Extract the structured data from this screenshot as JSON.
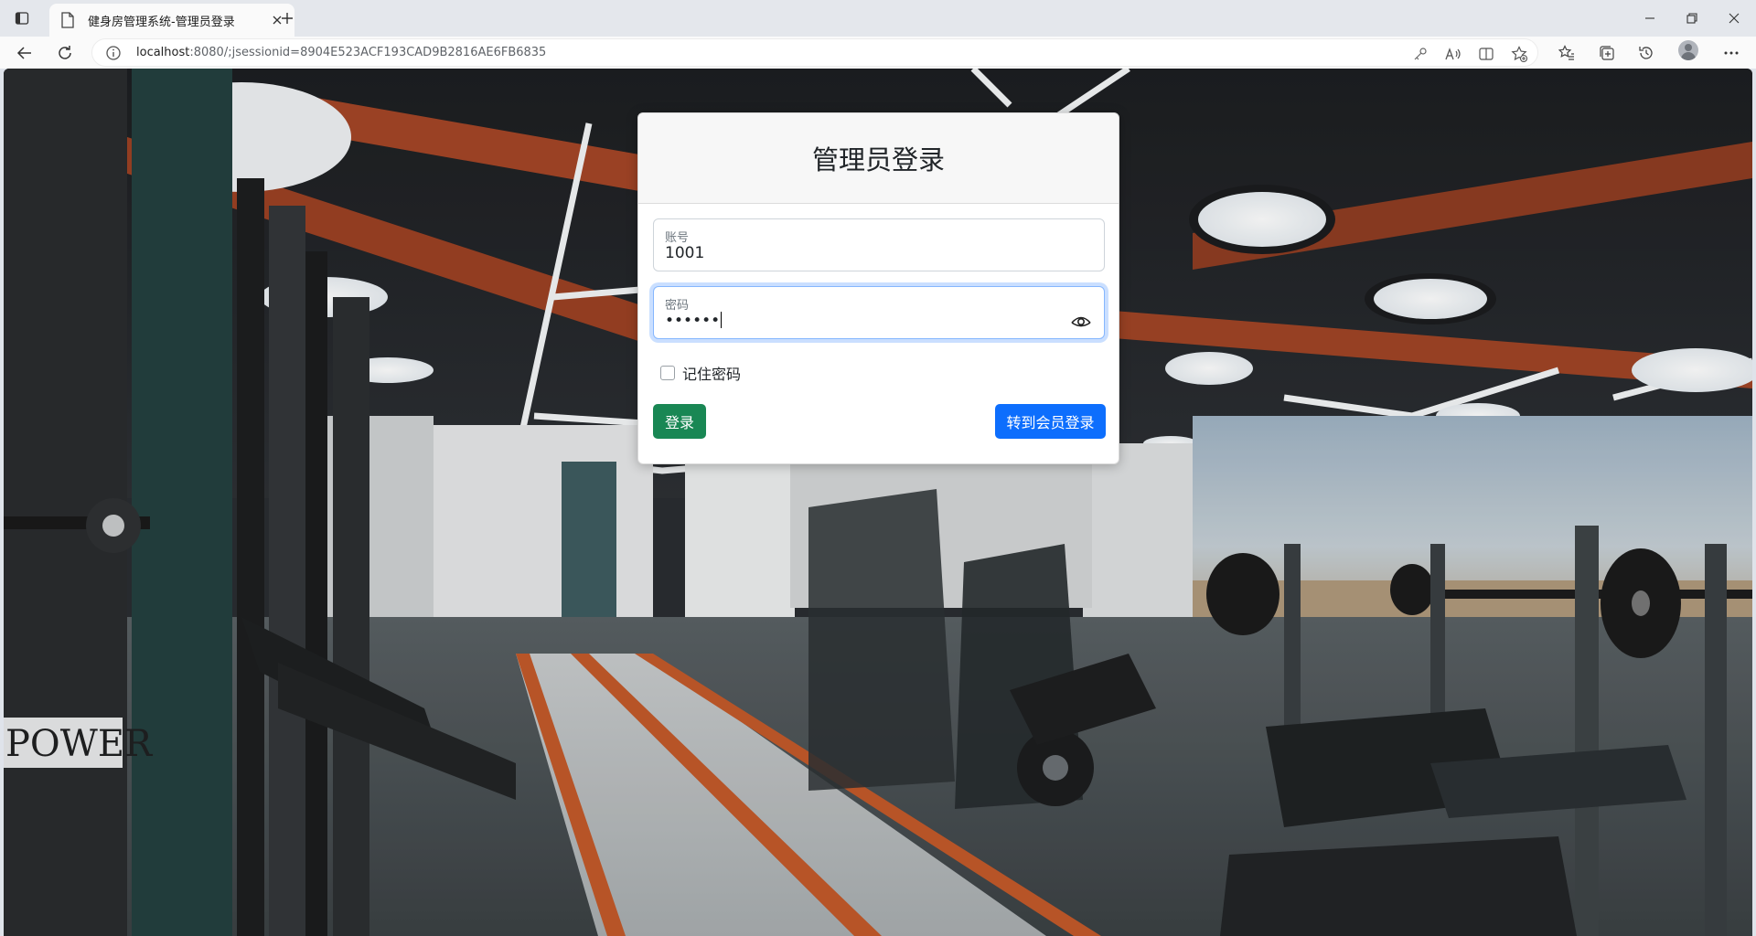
{
  "browser": {
    "tab": {
      "title": "健身房管理系统-管理员登录"
    },
    "address": {
      "host": "localhost",
      "rest": ":8080/;jsessionid=8904E523ACF193CAD9B2816AE6FB6835"
    },
    "icons": [
      "tab-strip-icon",
      "page-icon",
      "close-icon",
      "plus-icon",
      "minimize-icon",
      "restore-icon",
      "close-window-icon",
      "back-icon",
      "refresh-icon",
      "info-icon",
      "key-icon",
      "read-aloud-icon",
      "split-screen-icon",
      "favorite-add-icon",
      "favorites-icon",
      "collections-icon",
      "history-icon",
      "profile-icon",
      "more-icon"
    ]
  },
  "login": {
    "title": "管理员登录",
    "account_label": "账号",
    "account_value": "1001",
    "password_label": "密码",
    "password_value": "••••••",
    "remember_label": "记住密码",
    "remember_checked": false,
    "login_button": "登录",
    "member_button": "转到会员登录"
  },
  "background": {
    "sign_text": "POWER"
  },
  "colors": {
    "login_button": "#198754",
    "member_button": "#0d6efd",
    "focus_ring": "#86b7fe"
  }
}
